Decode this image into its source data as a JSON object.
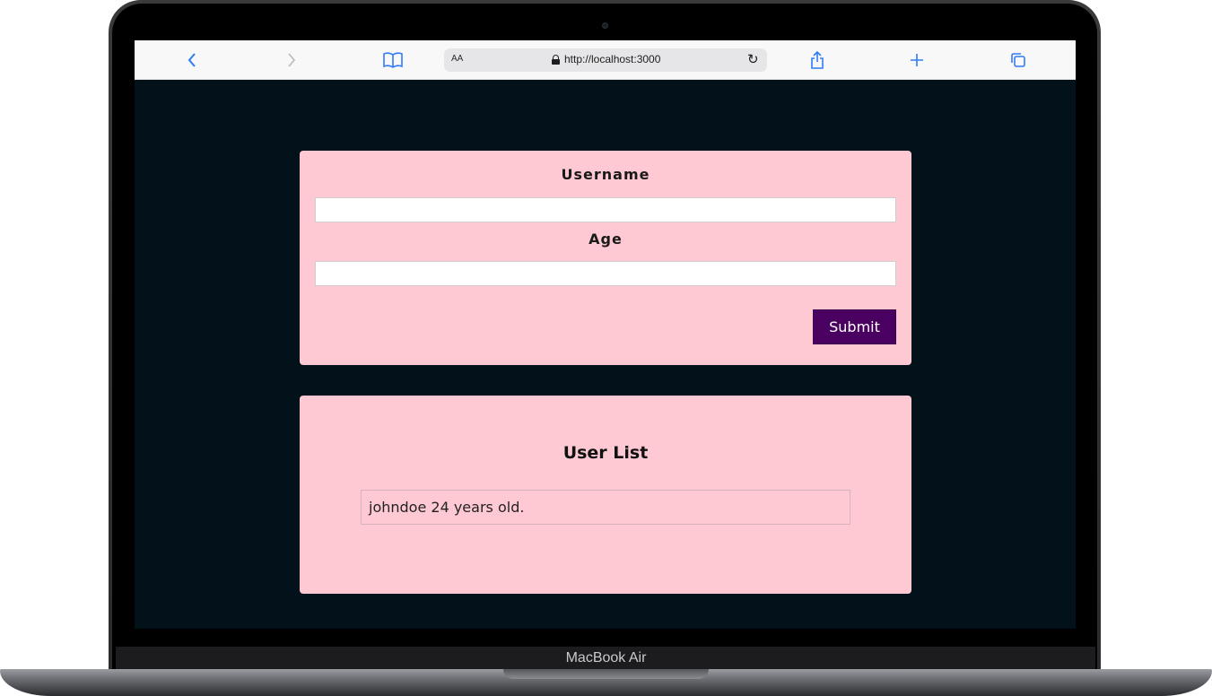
{
  "device": {
    "brand_label": "MacBook Air"
  },
  "browser": {
    "text_size_label": "AA",
    "url": "http://localhost:3000",
    "icons": [
      "back-icon",
      "forward-icon",
      "bookmarks-icon",
      "lock-icon",
      "reload-icon",
      "share-icon",
      "new-tab-icon",
      "tabs-icon"
    ],
    "accent_color": "#2f7cf6"
  },
  "form": {
    "username_label": "Username",
    "username_value": "",
    "age_label": "Age",
    "age_value": "",
    "submit_label": "Submit"
  },
  "user_list": {
    "title": "User List",
    "items": [
      {
        "text": "johndoe 24 years old."
      }
    ]
  },
  "colors": {
    "page_background": "#03121a",
    "card_background": "#ffc9d4",
    "button_background": "#4a0060"
  }
}
